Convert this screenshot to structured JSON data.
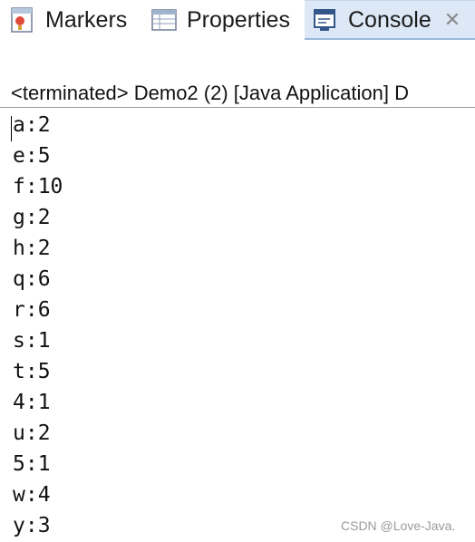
{
  "tabs": [
    {
      "id": "markers",
      "label": "Markers",
      "icon": "markers-icon",
      "active": false
    },
    {
      "id": "properties",
      "label": "Properties",
      "icon": "properties-icon",
      "active": false
    },
    {
      "id": "console",
      "label": "Console",
      "icon": "console-icon",
      "active": true,
      "close": "✕"
    }
  ],
  "console": {
    "status": "<terminated> Demo2 (2) [Java Application] D",
    "lines": [
      "a:2",
      "e:5",
      "f:10",
      "g:2",
      "h:2",
      "q:6",
      "r:6",
      "s:1",
      "t:5",
      "4:1",
      "u:2",
      "5:1",
      "w:4",
      "y:3"
    ]
  },
  "watermark": "CSDN @Love-Java.",
  "colors": {
    "active_tab_bg": "#dce8f6",
    "text": "#111111",
    "divider": "#9a9a9a"
  }
}
